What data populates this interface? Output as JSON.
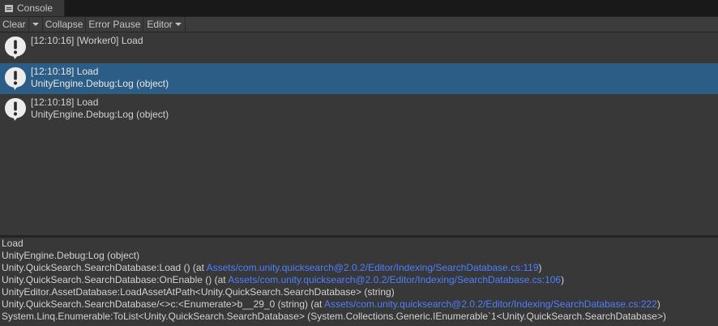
{
  "tab": {
    "title": "Console",
    "icon": "console-icon"
  },
  "toolbar": {
    "clear_label": "Clear",
    "collapse_label": "Collapse",
    "error_pause_label": "Error Pause",
    "editor_label": "Editor"
  },
  "log_entries": [
    {
      "line1": "[12:10:16] [Worker0] Load",
      "line2": "",
      "icon": "info-icon",
      "selected": false
    },
    {
      "line1": "[12:10:18] Load",
      "line2": "UnityEngine.Debug:Log (object)",
      "icon": "info-icon",
      "selected": true
    },
    {
      "line1": "[12:10:18] Load",
      "line2": "UnityEngine.Debug:Log (object)",
      "icon": "info-icon",
      "selected": false
    }
  ],
  "detail": {
    "line0": "Load",
    "line1": "UnityEngine.Debug:Log (object)",
    "line2_pre": "Unity.QuickSearch.SearchDatabase:Load () (at ",
    "line2_link": "Assets/com.unity.quicksearch@2.0.2/Editor/Indexing/SearchDatabase.cs:119",
    "line2_post": ")",
    "line3_pre": "Unity.QuickSearch.SearchDatabase:OnEnable () (at ",
    "line3_link": "Assets/com.unity.quicksearch@2.0.2/Editor/Indexing/SearchDatabase.cs:106",
    "line3_post": ")",
    "line4": "UnityEditor.AssetDatabase:LoadAssetAtPath<Unity.QuickSearch.SearchDatabase> (string)",
    "line5_pre": "Unity.QuickSearch.SearchDatabase/<>c:<Enumerate>b__29_0 (string) (at ",
    "line5_link": "Assets/com.unity.quicksearch@2.0.2/Editor/Indexing/SearchDatabase.cs:222",
    "line5_post": ")",
    "line6": "System.Linq.Enumerable:ToList<Unity.QuickSearch.SearchDatabase> (System.Collections.Generic.IEnumerable`1<Unity.QuickSearch.SearchDatabase>)"
  },
  "colors": {
    "background": "#383838",
    "selected_row": "#2c5d87",
    "link": "#4c7fff",
    "text": "#d2d2d2"
  }
}
